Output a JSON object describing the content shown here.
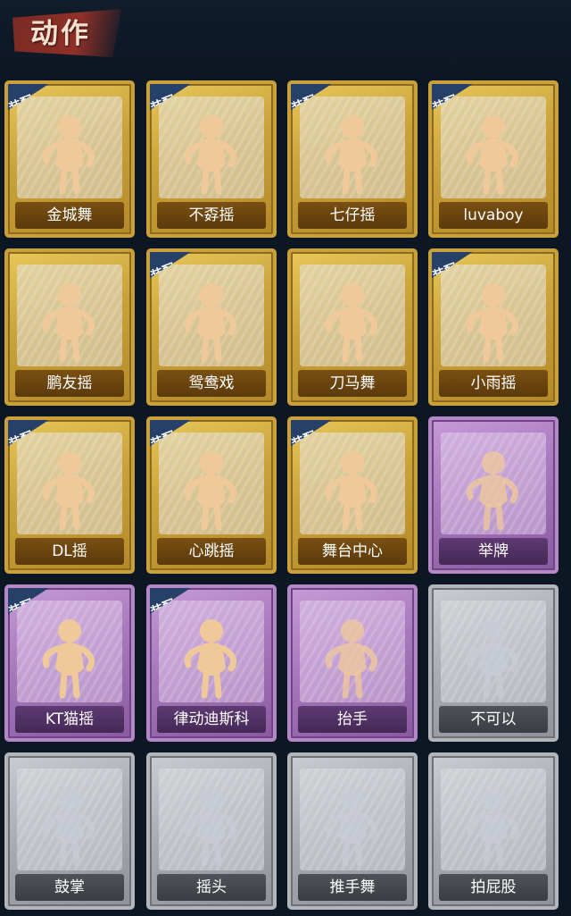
{
  "header": {
    "title": "动作"
  },
  "badge_text": "装配",
  "colors": {
    "gold": "#caa03c",
    "purple": "#b488c6",
    "gray": "#b2b6bb",
    "badge": "#27406a",
    "title_banner": "#8f3128"
  },
  "cards": [
    {
      "label": "金城舞",
      "tier": "gold",
      "equipped": true,
      "icon": "dance-pose-icon"
    },
    {
      "label": "不孬摇",
      "tier": "gold",
      "equipped": true,
      "icon": "dance-pose-icon"
    },
    {
      "label": "七仔摇",
      "tier": "gold",
      "equipped": true,
      "icon": "dance-pose-icon"
    },
    {
      "label": "luvaboy",
      "tier": "gold",
      "equipped": true,
      "icon": "dance-pose-icon"
    },
    {
      "label": "鹏友摇",
      "tier": "gold",
      "equipped": false,
      "icon": "dance-pose-icon"
    },
    {
      "label": "鸳鸯戏",
      "tier": "gold",
      "equipped": true,
      "icon": "dance-pose-icon"
    },
    {
      "label": "刀马舞",
      "tier": "gold",
      "equipped": false,
      "icon": "dance-pose-icon"
    },
    {
      "label": "小雨摇",
      "tier": "gold",
      "equipped": true,
      "icon": "dance-pose-icon"
    },
    {
      "label": "DL摇",
      "tier": "gold",
      "equipped": true,
      "icon": "dance-pose-icon"
    },
    {
      "label": "心跳摇",
      "tier": "gold",
      "equipped": true,
      "icon": "dance-pose-icon"
    },
    {
      "label": "舞台中心",
      "tier": "gold",
      "equipped": true,
      "icon": "dance-pose-icon"
    },
    {
      "label": "举牌",
      "tier": "purple",
      "equipped": false,
      "icon": "sign-holding-icon"
    },
    {
      "label": "KT猫摇",
      "tier": "purple",
      "equipped": true,
      "icon": "dance-pose-icon"
    },
    {
      "label": "律动迪斯科",
      "tier": "purple",
      "equipped": true,
      "icon": "dance-pose-icon"
    },
    {
      "label": "抬手",
      "tier": "purple",
      "equipped": false,
      "icon": "raise-hand-icon"
    },
    {
      "label": "不可以",
      "tier": "gray",
      "equipped": false,
      "icon": "finger-wag-icon"
    },
    {
      "label": "鼓掌",
      "tier": "gray",
      "equipped": false,
      "icon": "clap-icon"
    },
    {
      "label": "摇头",
      "tier": "gray",
      "equipped": false,
      "icon": "head-shake-icon"
    },
    {
      "label": "推手舞",
      "tier": "gray",
      "equipped": false,
      "icon": "push-hands-icon"
    },
    {
      "label": "拍屁股",
      "tier": "gray",
      "equipped": false,
      "icon": "butt-slap-icon"
    }
  ]
}
